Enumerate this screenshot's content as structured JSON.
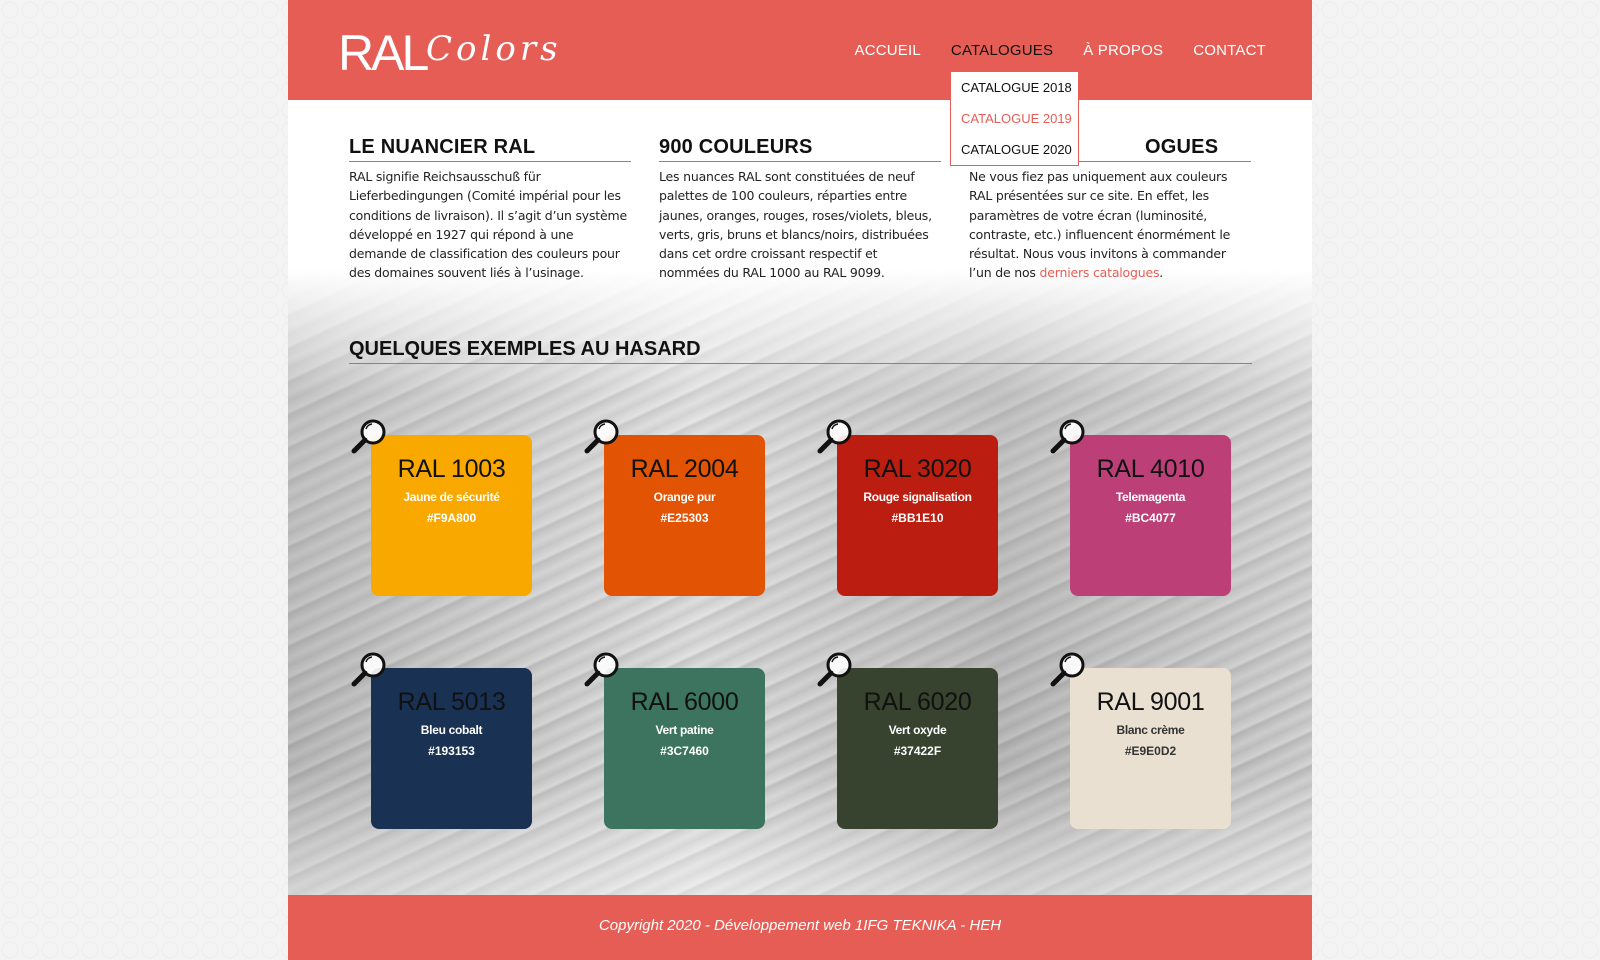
{
  "logo": {
    "part1": "RAL",
    "part2": "Colors"
  },
  "nav": {
    "items": [
      "ACCUEIL",
      "CATALOGUES",
      "À PROPOS",
      "CONTACT"
    ],
    "active": "CATALOGUES"
  },
  "dropdown": {
    "items": [
      "CATALOGUE 2018",
      "CATALOGUE 2019",
      "CATALOGUE 2020"
    ],
    "hovered": "CATALOGUE 2019"
  },
  "sections": [
    {
      "title": "LE NUANCIER RAL",
      "text": "RAL signifie Reichsausschuß für Lieferbedingungen (Comité impérial pour les conditions de livraison). Il s’agit d’un système développé en 1927 qui répond à une demande de classification des couleurs pour des domaines souvent liés à l’usinage."
    },
    {
      "title": "900 COULEURS",
      "text": "Les nuances RAL sont constituées de neuf palettes de 100 couleurs, réparties entre jaunes, oranges, rouges, roses/violets, bleus, verts, gris, bruns et blancs/noirs, distribuées dans cet ordre croissant respectif et nommées du RAL 1000 au RAL 9099."
    },
    {
      "title": "OGUES",
      "text_before": "Ne vous fiez pas uniquement aux couleurs RAL présentées sur ce site. En effet, les paramètres de votre écran (luminosité, contraste, etc.) influencent énormément le résultat. Nous vous invitons à commander l’un de nos ",
      "link": "derniers catalogues",
      "text_after": "."
    }
  ],
  "examples": {
    "title": "QUELQUES EXEMPLES AU HASARD",
    "swatches": [
      {
        "code": "RAL 1003",
        "name": "Jaune de sécurité",
        "hex": "#F9A800",
        "color": "#F9A800",
        "text_color": "#ffffff"
      },
      {
        "code": "RAL 2004",
        "name": "Orange pur",
        "hex": "#E25303",
        "color": "#E25303",
        "text_color": "#ffffff"
      },
      {
        "code": "RAL 3020",
        "name": "Rouge signalisation",
        "hex": "#BB1E10",
        "color": "#BB1E10",
        "text_color": "#ffffff"
      },
      {
        "code": "RAL 4010",
        "name": "Telemagenta",
        "hex": "#BC4077",
        "color": "#BC4077",
        "text_color": "#ffffff"
      },
      {
        "code": "RAL 5013",
        "name": "Bleu cobalt",
        "hex": "#193153",
        "color": "#193153",
        "text_color": "#ffffff"
      },
      {
        "code": "RAL 6000",
        "name": "Vert patine",
        "hex": "#3C7460",
        "color": "#3C7460",
        "text_color": "#ffffff"
      },
      {
        "code": "RAL 6020",
        "name": "Vert oxyde",
        "hex": "#37422F",
        "color": "#37422F",
        "text_color": "#ffffff"
      },
      {
        "code": "RAL 9001",
        "name": "Blanc crème",
        "hex": "#E9E0D2",
        "color": "#E9E0D2",
        "text_color": "#333333"
      }
    ]
  },
  "footer": {
    "text": "Copyright 2020 - Développement web 1IFG TEKNIKA - HEH"
  },
  "colors": {
    "brand": "#e55d55"
  },
  "icons": {
    "swatch_zoom": "magnifier-icon"
  }
}
